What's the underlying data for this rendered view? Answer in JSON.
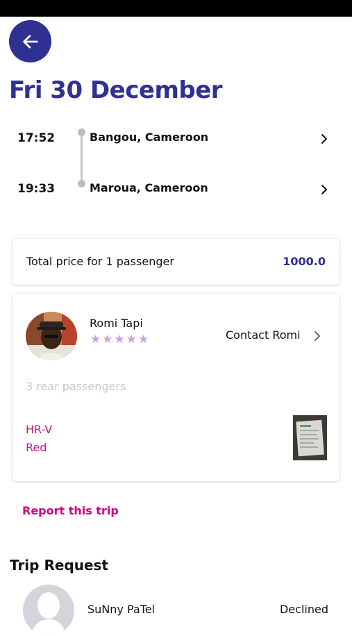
{
  "header": {
    "date": "Fri 30 December"
  },
  "route": {
    "stops": [
      {
        "time": "17:52",
        "place": "Bangou, Cameroon"
      },
      {
        "time": "19:33",
        "place": "Maroua, Cameroon"
      }
    ]
  },
  "price": {
    "label": "Total price for 1 passenger",
    "value": "1000.0"
  },
  "driver": {
    "name": "Romi Tapi",
    "rating": 5,
    "stars": "★★★★★",
    "contact_label": "Contact Romi",
    "passengers": "3 rear passengers",
    "car_model": "HR-V",
    "car_color": "Red"
  },
  "actions": {
    "report_label": "Report this trip"
  },
  "trip_request": {
    "title": "Trip Request",
    "requests": [
      {
        "name": "SuNny PaTel",
        "status": "Declined"
      }
    ]
  },
  "colors": {
    "brand": "#2e3192",
    "accent": "#c2188b",
    "report": "#d6007f",
    "stars": "#c9a3e2"
  },
  "icons": {
    "back": "arrow-left-icon",
    "chevron": "chevron-right-icon"
  }
}
